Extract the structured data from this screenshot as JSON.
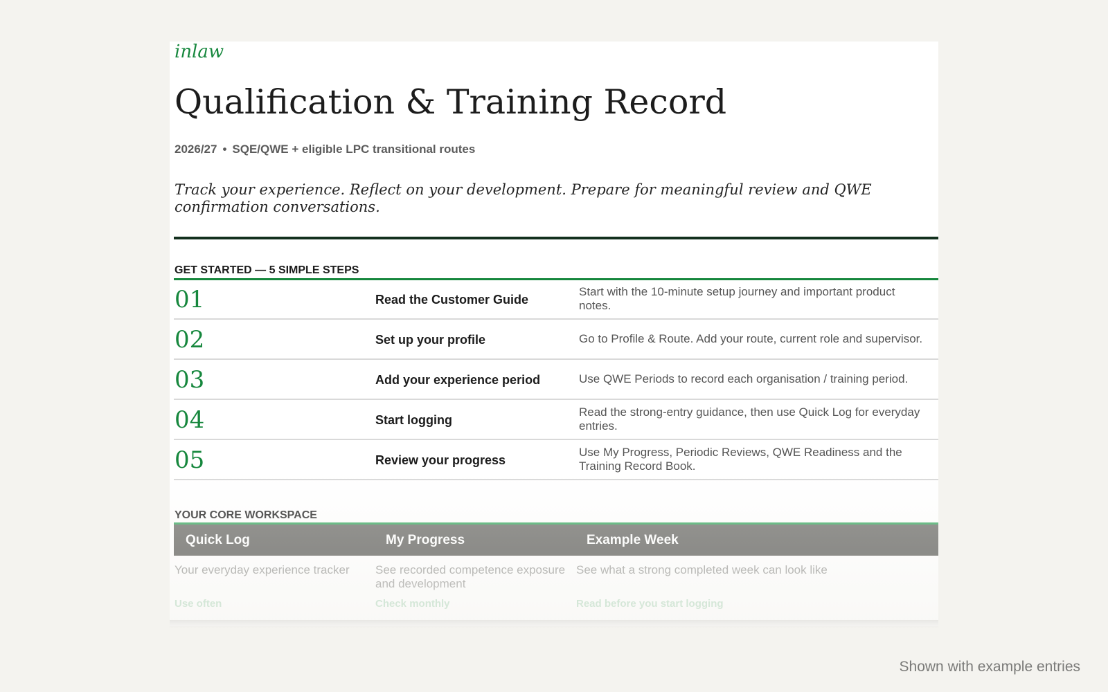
{
  "brand": "inlaw",
  "title": "Qualification & Training Record",
  "meta": {
    "year": "2026/27",
    "separator": "•",
    "routes": "SQE/QWE + eligible LPC transitional routes"
  },
  "tagline": "Track your experience. Reflect on your development. Prepare for meaningful review and QWE confirmation conversations.",
  "get_started": {
    "heading": "GET STARTED — 5 SIMPLE STEPS",
    "steps": [
      {
        "num": "01",
        "label": "Read the Customer Guide",
        "desc": "Start with the 10-minute setup journey and important product notes."
      },
      {
        "num": "02",
        "label": "Set up your profile",
        "desc": "Go to Profile & Route. Add your route, current role and supervisor."
      },
      {
        "num": "03",
        "label": "Add your experience period",
        "desc": "Use QWE Periods to record each organisation / training period."
      },
      {
        "num": "04",
        "label": "Start logging",
        "desc": "Read the strong-entry guidance, then use Quick Log for everyday entries."
      },
      {
        "num": "05",
        "label": "Review your progress",
        "desc": "Use My Progress, Periodic Reviews, QWE Readiness and the Training Record Book."
      }
    ]
  },
  "core_workspace": {
    "heading": "YOUR CORE WORKSPACE",
    "items": [
      {
        "title": "Quick Log",
        "desc": "Your everyday experience tracker",
        "hint": "Use often"
      },
      {
        "title": "My Progress",
        "desc": "See recorded competence exposure and development",
        "hint": "Check monthly"
      },
      {
        "title": "Example Week",
        "desc": "See what a strong completed week can look like",
        "hint": "Read before you start logging"
      }
    ]
  },
  "footer_note": "Shown with example entries",
  "colors": {
    "accent_green": "#16873d",
    "dark_rule": "#13301e",
    "page_background": "#f4f3ef"
  }
}
